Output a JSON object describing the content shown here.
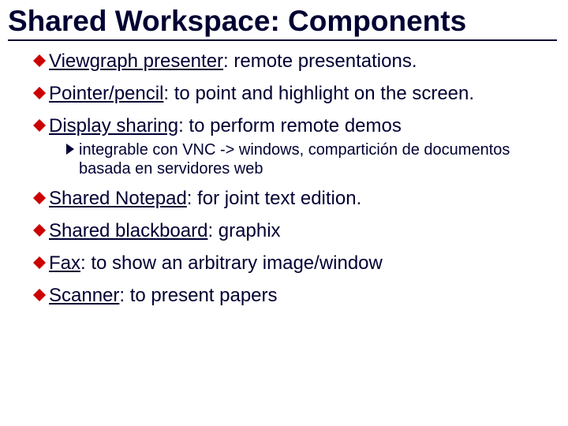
{
  "title": "Shared Workspace: Components",
  "bullets": [
    {
      "term": "Viewgraph presenter",
      "desc": ": remote presentations."
    },
    {
      "term": "Pointer/pencil",
      "desc": ": to point and highlight on the screen."
    },
    {
      "term": "Display sharing",
      "desc": ": to perform remote demos",
      "sub": "integrable con VNC -> windows, compartición de documentos basada en servidores web"
    },
    {
      "term": "Shared Notepad",
      "desc": ": for joint text edition."
    },
    {
      "term": "Shared blackboard",
      "desc": ": graphix"
    },
    {
      "term": "Fax",
      "desc": ": to show an arbitrary image/window"
    },
    {
      "term": "Scanner",
      "desc": ": to present papers"
    }
  ],
  "colors": {
    "accent": "#cc0000",
    "text": "#000033"
  }
}
